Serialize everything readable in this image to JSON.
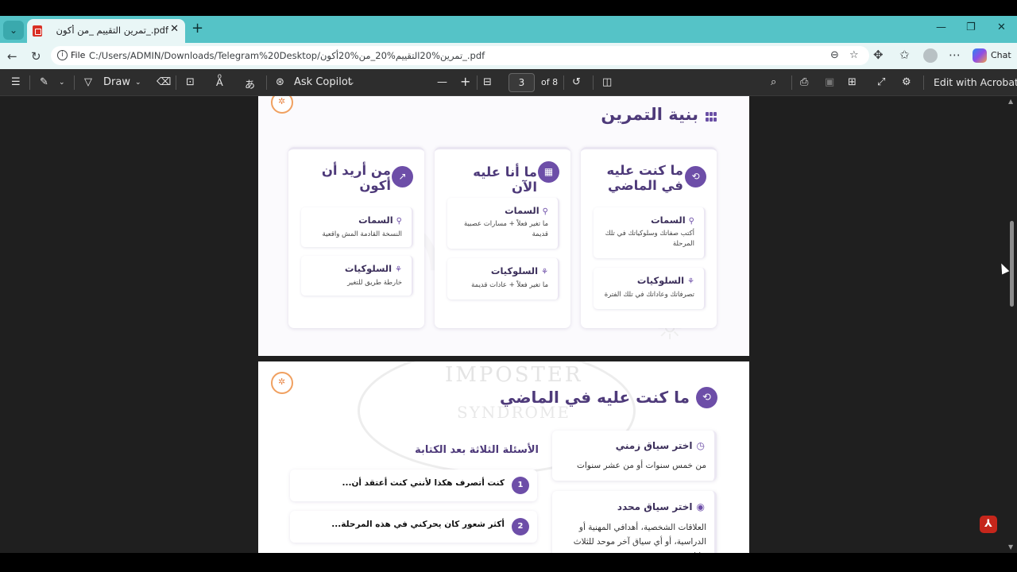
{
  "browser": {
    "tab_title": "تمرين التقييم _من أكون_.pdf",
    "address_scheme_label": "File",
    "url": "C:/Users/ADMIN/Downloads/Telegram%20Desktop/تمرين%20التقييم%20_من%20أكون_.pdf",
    "chat_label": "Chat"
  },
  "pdf_toolbar": {
    "draw_label": "Draw",
    "copilot_label": "Ask Copilot",
    "zoom_out": "—",
    "zoom_in": "+",
    "page_current": "3",
    "page_total": "of 8",
    "edit_label": "Edit with Acrobat"
  },
  "page1": {
    "title": "بنية التمرين",
    "cards": [
      {
        "title": "ما كنت عليه في الماضي",
        "items": [
          {
            "head": "السمات",
            "body": "أكتب صفاتك وسلوكياتك في تلك المرحلة"
          },
          {
            "head": "السلوكيات",
            "body": "تصرفاتك وعاداتك في تلك الفترة"
          }
        ]
      },
      {
        "title": "ما أنا عليه الآن",
        "items": [
          {
            "head": "السمات",
            "body": "ما تغير فعلاً + مسارات عصبية قديمة"
          },
          {
            "head": "السلوكيات",
            "body": "ما تغير فعلاً + عادات قديمة"
          }
        ]
      },
      {
        "title": "من أريد أن أكون",
        "items": [
          {
            "head": "السمات",
            "body": "النسخة القادمة المش واقعية"
          },
          {
            "head": "السلوكيات",
            "body": "خارطة طريق للتغير"
          }
        ]
      }
    ]
  },
  "page2": {
    "title": "ما كنت عليه في الماضي",
    "doodle_text_1": "IMPOSTER",
    "doodle_text_2": "SYNDROME",
    "info_cards": [
      {
        "head": "اختر سياق زمني",
        "body": "من خمس سنوات أو من عشر سنوات"
      },
      {
        "head": "اختر سياق محدد",
        "body": "العلاقات الشخصية، أهدافي المهنية أو الدراسية، أو أي سياق آخر موحد للثلاث خانات"
      }
    ],
    "questions_title": "الأسئلة الثلاثة بعد الكتابة",
    "questions": [
      {
        "num": "1",
        "text": "كنت أتصرف هكذا لأنني كنت أعتقد أن..."
      },
      {
        "num": "2",
        "text": "أكثر شعور كان يحركني في هذه المرحلة..."
      }
    ]
  }
}
